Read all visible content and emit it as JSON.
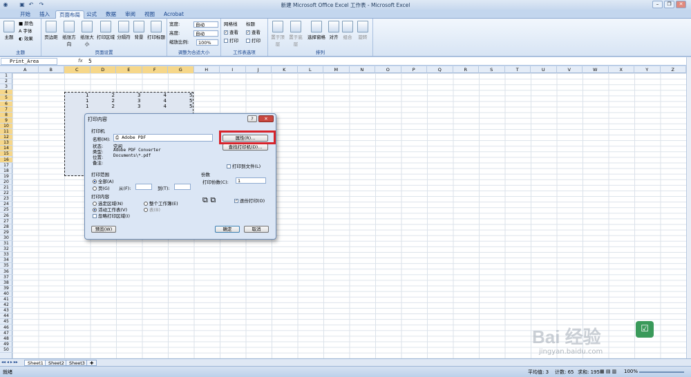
{
  "app": {
    "title": "新建 Microsoft Office Excel 工作表 - Microsoft Excel"
  },
  "tabs": [
    "开始",
    "插入",
    "页面布局",
    "公式",
    "数据",
    "审阅",
    "视图",
    "Acrobat"
  ],
  "ribbon": {
    "theme": {
      "label": "主题",
      "colors": "颜色",
      "fonts": "字体",
      "effects": "效果",
      "group": "主题"
    },
    "pagesetup": {
      "buttons": [
        "页边距",
        "纸张方向",
        "纸张大小",
        "打印区域",
        "分隔符",
        "背景",
        "打印标题"
      ],
      "group": "页面设置"
    },
    "scale": {
      "width_label": "宽度:",
      "width_val": "自动",
      "height_label": "高度:",
      "height_val": "自动",
      "scale_label": "缩放比例:",
      "scale_val": "100%",
      "group": "调整为合适大小"
    },
    "sheetopts": {
      "grid": "网格线",
      "headings": "标题",
      "view": "查看",
      "print": "打印",
      "group": "工作表选项"
    },
    "arrange": {
      "buttons": [
        "置于顶层",
        "置于底层",
        "选择窗格",
        "对齐",
        "组合",
        "旋转"
      ],
      "group": "排列"
    }
  },
  "formula": {
    "namebox": "Print_Area",
    "fx": "fx",
    "value": "5"
  },
  "columns": [
    "A",
    "B",
    "C",
    "D",
    "E",
    "F",
    "G",
    "H",
    "I",
    "J",
    "K",
    "L",
    "M",
    "N",
    "O",
    "P",
    "Q",
    "R",
    "S",
    "T",
    "U",
    "V",
    "W",
    "X",
    "Y",
    "Z"
  ],
  "rows": [
    "1",
    "2",
    "3",
    "4",
    "5",
    "6",
    "7",
    "8",
    "9",
    "10",
    "11",
    "12",
    "13",
    "14",
    "15",
    "16",
    "17",
    "18",
    "19",
    "20",
    "21",
    "22",
    "23",
    "24",
    "25",
    "26",
    "27",
    "28",
    "29",
    "30",
    "31",
    "32",
    "33",
    "34",
    "35",
    "36",
    "37",
    "38",
    "39",
    "40",
    "41",
    "42",
    "43",
    "44",
    "45",
    "46",
    "47",
    "48",
    "49",
    "50"
  ],
  "data_rows": [
    [
      "1",
      "2",
      "3",
      "4",
      "5"
    ],
    [
      "1",
      "2",
      "3",
      "4",
      "5"
    ],
    [
      "1",
      "2",
      "3",
      "4",
      "5"
    ]
  ],
  "dialog": {
    "title": "打印内容",
    "printer_section": "打印机",
    "name_label": "名称(M):",
    "printer_name": "Adobe PDF",
    "props_btn": "属性(R)...",
    "find_btn": "查找打印机(D)...",
    "status_label": "状态:",
    "status_val": "空闲",
    "type_label": "类型:",
    "type_val": "Adobe PDF Converter",
    "where_label": "位置:",
    "where_val": "Documents\\*.pdf",
    "comment_label": "备注:",
    "print_to_file": "打印到文件(L)",
    "range_section": "打印范围",
    "all": "全部(A)",
    "pages": "页(G)",
    "from": "从(F):",
    "to": "到(T):",
    "copies_section": "份数",
    "copies_label": "打印份数(C):",
    "copies_val": "1",
    "what_section": "打印内容",
    "selection": "选定区域(N)",
    "workbook": "整个工作簿(E)",
    "active_sheet": "活动工作表(V)",
    "table": "表(B)",
    "ignore": "忽略打印区域(I)",
    "collate": "逐份打印(O)",
    "preview": "预览(W)",
    "ok": "确定",
    "cancel": "取消"
  },
  "sheets": [
    "Sheet1",
    "Sheet2",
    "Sheet3"
  ],
  "status": {
    "ready": "就绪",
    "average": "平均值: 3",
    "count": "计数: 65",
    "sum": "求和: 195",
    "zoom": "100%"
  },
  "watermark": {
    "text": "Bai 经验",
    "url": "jingyan.baidu.com"
  }
}
